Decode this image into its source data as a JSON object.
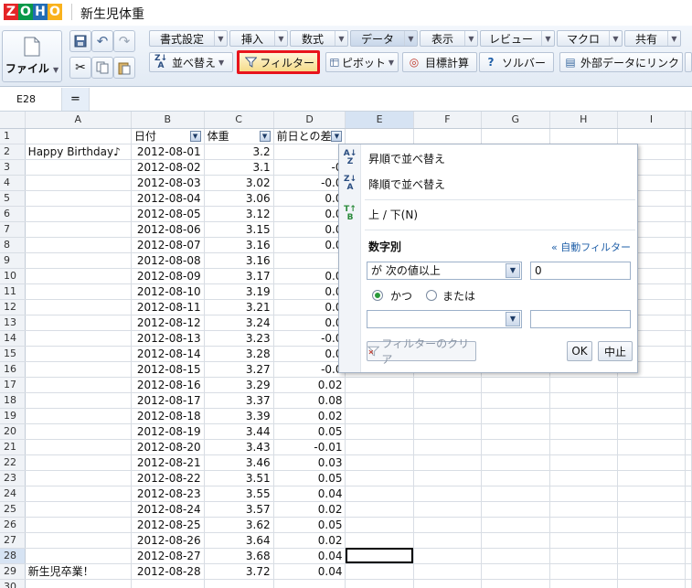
{
  "app": {
    "logo_letters": [
      "Z",
      "O",
      "H",
      "O"
    ],
    "logo_colors": [
      "#e42527",
      "#089949",
      "#226db4",
      "#f9b21d"
    ],
    "doc_title": "新生児体重"
  },
  "toolbar": {
    "file_label": "ファイル",
    "tabs": [
      {
        "label": "書式設定"
      },
      {
        "label": "挿入"
      },
      {
        "label": "数式"
      },
      {
        "label": "データ"
      },
      {
        "label": "表示"
      },
      {
        "label": "レビュー"
      },
      {
        "label": "マクロ"
      },
      {
        "label": "共有"
      }
    ],
    "ribbon": {
      "sort_label": "並べ替え",
      "filter_label": "フィルター",
      "pivot_label": "ピボット",
      "goal_seek_label": "目標計算",
      "solver_label": "ソルバー",
      "external_link_label": "外部データにリンク"
    },
    "highlight_color": "#e8141c"
  },
  "formula_bar": {
    "cell_ref": "E28",
    "eq_symbol": "="
  },
  "grid": {
    "columns": [
      "A",
      "B",
      "C",
      "D",
      "E",
      "F",
      "G",
      "H",
      "I"
    ],
    "header_row": {
      "b": "日付",
      "c": "体重",
      "d": "前日との差"
    },
    "rows": [
      {
        "n": "2",
        "a": "Happy Birthday♪",
        "b": "2012-08-01",
        "c": "3.2",
        "d": ""
      },
      {
        "n": "3",
        "a": "",
        "b": "2012-08-02",
        "c": "3.1",
        "d": "-0"
      },
      {
        "n": "4",
        "a": "",
        "b": "2012-08-03",
        "c": "3.02",
        "d": "-0.0"
      },
      {
        "n": "5",
        "a": "",
        "b": "2012-08-04",
        "c": "3.06",
        "d": "0.0"
      },
      {
        "n": "6",
        "a": "",
        "b": "2012-08-05",
        "c": "3.12",
        "d": "0.0"
      },
      {
        "n": "7",
        "a": "",
        "b": "2012-08-06",
        "c": "3.15",
        "d": "0.0"
      },
      {
        "n": "8",
        "a": "",
        "b": "2012-08-07",
        "c": "3.16",
        "d": "0.0"
      },
      {
        "n": "9",
        "a": "",
        "b": "2012-08-08",
        "c": "3.16",
        "d": ""
      },
      {
        "n": "10",
        "a": "",
        "b": "2012-08-09",
        "c": "3.17",
        "d": "0.0"
      },
      {
        "n": "11",
        "a": "",
        "b": "2012-08-10",
        "c": "3.19",
        "d": "0.0"
      },
      {
        "n": "12",
        "a": "",
        "b": "2012-08-11",
        "c": "3.21",
        "d": "0.0"
      },
      {
        "n": "13",
        "a": "",
        "b": "2012-08-12",
        "c": "3.24",
        "d": "0.0"
      },
      {
        "n": "14",
        "a": "",
        "b": "2012-08-13",
        "c": "3.23",
        "d": "-0.0"
      },
      {
        "n": "15",
        "a": "",
        "b": "2012-08-14",
        "c": "3.28",
        "d": "0.0"
      },
      {
        "n": "16",
        "a": "",
        "b": "2012-08-15",
        "c": "3.27",
        "d": "-0.0"
      },
      {
        "n": "17",
        "a": "",
        "b": "2012-08-16",
        "c": "3.29",
        "d": "0.02"
      },
      {
        "n": "18",
        "a": "",
        "b": "2012-08-17",
        "c": "3.37",
        "d": "0.08"
      },
      {
        "n": "19",
        "a": "",
        "b": "2012-08-18",
        "c": "3.39",
        "d": "0.02"
      },
      {
        "n": "20",
        "a": "",
        "b": "2012-08-19",
        "c": "3.44",
        "d": "0.05"
      },
      {
        "n": "21",
        "a": "",
        "b": "2012-08-20",
        "c": "3.43",
        "d": "-0.01"
      },
      {
        "n": "22",
        "a": "",
        "b": "2012-08-21",
        "c": "3.46",
        "d": "0.03"
      },
      {
        "n": "23",
        "a": "",
        "b": "2012-08-22",
        "c": "3.51",
        "d": "0.05"
      },
      {
        "n": "24",
        "a": "",
        "b": "2012-08-23",
        "c": "3.55",
        "d": "0.04"
      },
      {
        "n": "25",
        "a": "",
        "b": "2012-08-24",
        "c": "3.57",
        "d": "0.02"
      },
      {
        "n": "26",
        "a": "",
        "b": "2012-08-25",
        "c": "3.62",
        "d": "0.05"
      },
      {
        "n": "27",
        "a": "",
        "b": "2012-08-26",
        "c": "3.64",
        "d": "0.02"
      },
      {
        "n": "28",
        "a": "",
        "b": "2012-08-27",
        "c": "3.68",
        "d": "0.04"
      },
      {
        "n": "29",
        "a": "新生児卒業！",
        "b": "2012-08-28",
        "c": "3.72",
        "d": "0.04"
      },
      {
        "n": "30",
        "a": "",
        "b": "",
        "c": "",
        "d": ""
      }
    ]
  },
  "filter_panel": {
    "sort_asc": "昇順で並べ替え",
    "sort_desc": "降順で並べ替え",
    "top_bottom": "上 / 下(N)",
    "section_title": "数字別",
    "auto_filter_link": "« 自動フィルター",
    "condition1": "が 次の値以上",
    "value1": "0",
    "and_label": "かつ",
    "or_label": "または",
    "condition2": "",
    "value2": "",
    "clear_label": "フィルターのクリア",
    "ok_label": "OK",
    "cancel_label": "中止"
  }
}
